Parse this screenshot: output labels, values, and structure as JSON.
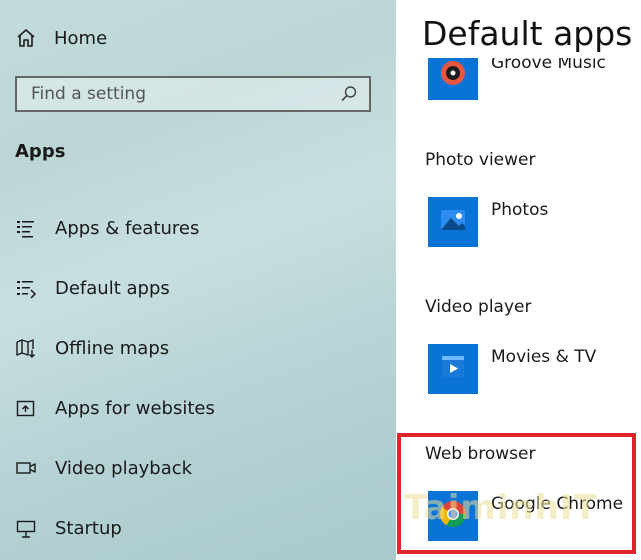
{
  "sidebar": {
    "home_label": "Home",
    "search_placeholder": "Find a setting",
    "section_title": "Apps",
    "items": [
      {
        "label": "Apps & features",
        "icon": "list-icon"
      },
      {
        "label": "Default apps",
        "icon": "default-apps-icon"
      },
      {
        "label": "Offline maps",
        "icon": "map-download-icon"
      },
      {
        "label": "Apps for websites",
        "icon": "open-in-icon"
      },
      {
        "label": "Video playback",
        "icon": "video-camera-icon"
      },
      {
        "label": "Startup",
        "icon": "startup-icon"
      }
    ]
  },
  "main": {
    "title": "Default apps",
    "music_app": "Groove Music",
    "photo_category": "Photo viewer",
    "photo_app": "Photos",
    "video_category": "Video player",
    "video_app": "Movies & TV",
    "browser_category": "Web browser",
    "browser_app": "Google Chrome"
  },
  "watermark": "TaiminhIT",
  "colors": {
    "accent": "#0a74d6",
    "highlight": "#e0242b"
  }
}
